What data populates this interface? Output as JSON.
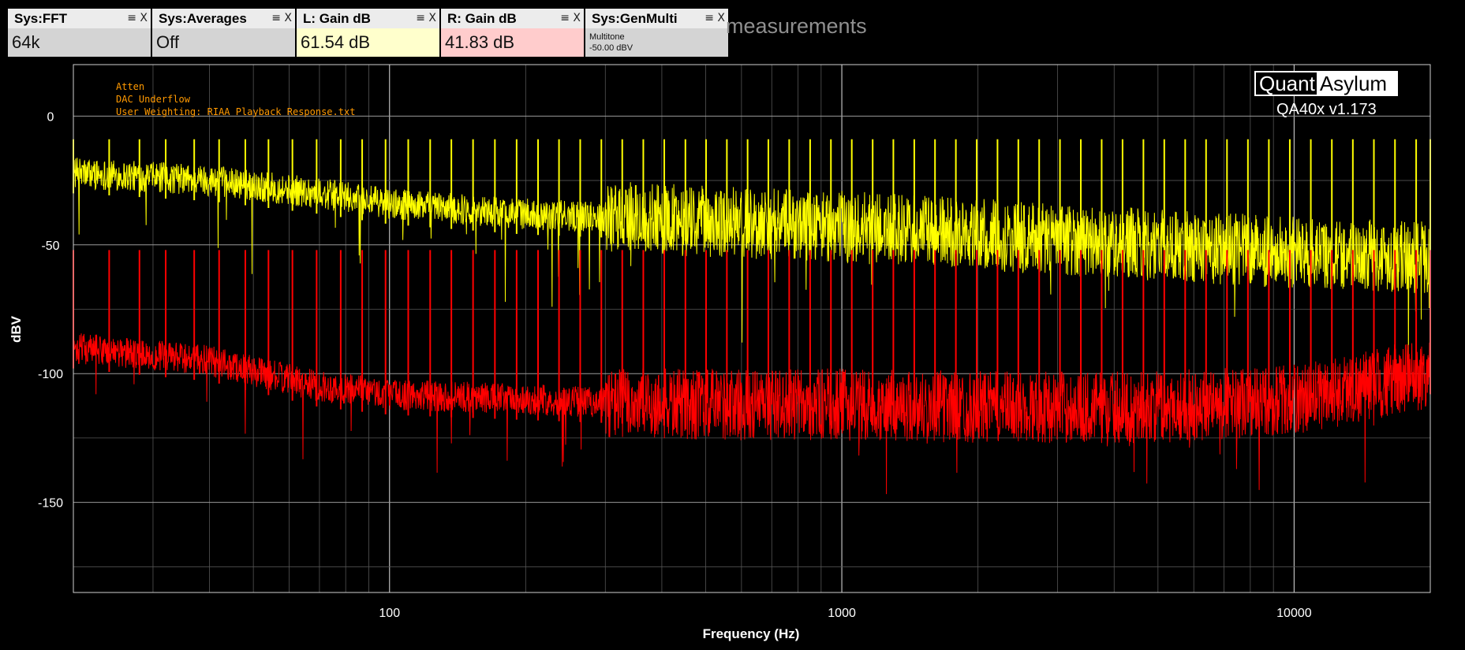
{
  "widgets": [
    {
      "title": "Sys:FFT",
      "value": "64k",
      "bg": "#d4d4d4"
    },
    {
      "title": "Sys:Averages",
      "value": "Off",
      "bg": "#d4d4d4"
    },
    {
      "title": "L: Gain dB",
      "value": "61.54 dB",
      "bg": "#ffffcc"
    },
    {
      "title": "R: Gain dB",
      "value": "41.83 dB",
      "bg": "#ffcccc"
    },
    {
      "title": "Sys:GenMulti",
      "sub1": "Multitone",
      "sub2": "-50.00 dBV",
      "bg": "#d4d4d4"
    }
  ],
  "widget_menu_icon": "≡",
  "widget_close_icon": "X",
  "background_title": "measurements",
  "logo": {
    "left": "Quant",
    "right": "Asylum"
  },
  "version": "QA40x v1.173",
  "annotations": [
    "Atten",
    "DAC Underflow",
    "User Weighting: RIAA Playback Response.txt"
  ],
  "chart_data": {
    "type": "line",
    "title": "",
    "xlabel": "Frequency (Hz)",
    "ylabel": "dBV",
    "x_scale": "log",
    "xlim": [
      20,
      20000
    ],
    "ylim": [
      -185,
      20
    ],
    "x_ticks": [
      100,
      1000,
      10000
    ],
    "x_tick_labels": [
      "100",
      "1000",
      "10000"
    ],
    "y_ticks": [
      0,
      -50,
      -100,
      -150
    ],
    "y_tick_labels": [
      "0",
      "-50",
      "-100",
      "-150"
    ],
    "grid": true,
    "series": [
      {
        "channel": "left",
        "color": "#ffff00",
        "tone_x": [
          20,
          24,
          28,
          32,
          37,
          42,
          48,
          54,
          61,
          69,
          78,
          87,
          98,
          110,
          123,
          137,
          153,
          171,
          191,
          213,
          237,
          264,
          294,
          327,
          364,
          405,
          451,
          501,
          557,
          619,
          688,
          765,
          851,
          946,
          1052,
          1170,
          1300,
          1446,
          1607,
          1787,
          1987,
          2209,
          2456,
          2731,
          3036,
          3376,
          3754,
          4175,
          4643,
          5163,
          5743,
          6387,
          7105,
          7904,
          8793,
          9783,
          10887,
          12117,
          13484,
          15009,
          16710,
          18612,
          20000
        ],
        "tone_peak_db": -9,
        "floor_x": [
          20,
          40,
          70,
          100,
          200,
          400,
          1000,
          2000,
          5000,
          10000,
          20000
        ],
        "floor_db": [
          -22,
          -25,
          -30,
          -34,
          -38,
          -40,
          -43,
          -46,
          -50,
          -53,
          -55
        ]
      },
      {
        "channel": "right",
        "color": "#ff0000",
        "tone_x": [
          20,
          24,
          28,
          32,
          37,
          42,
          48,
          54,
          61,
          69,
          78,
          87,
          98,
          110,
          123,
          137,
          153,
          171,
          191,
          213,
          237,
          264,
          294,
          327,
          364,
          405,
          451,
          501,
          557,
          619,
          688,
          765,
          851,
          946,
          1052,
          1170,
          1300,
          1446,
          1607,
          1787,
          1987,
          2209,
          2456,
          2731,
          3036,
          3376,
          3754,
          4175,
          4643,
          5163,
          5743,
          6387,
          7105,
          7904,
          8793,
          9783,
          10887,
          12117,
          13484,
          15009,
          16710,
          18612,
          20000
        ],
        "tone_peak_db": -52,
        "floor_x": [
          20,
          40,
          70,
          100,
          200,
          400,
          1000,
          2000,
          5000,
          10000,
          20000
        ],
        "floor_db": [
          -90,
          -95,
          -105,
          -108,
          -110,
          -112,
          -112,
          -113,
          -113,
          -110,
          -100
        ]
      }
    ]
  }
}
